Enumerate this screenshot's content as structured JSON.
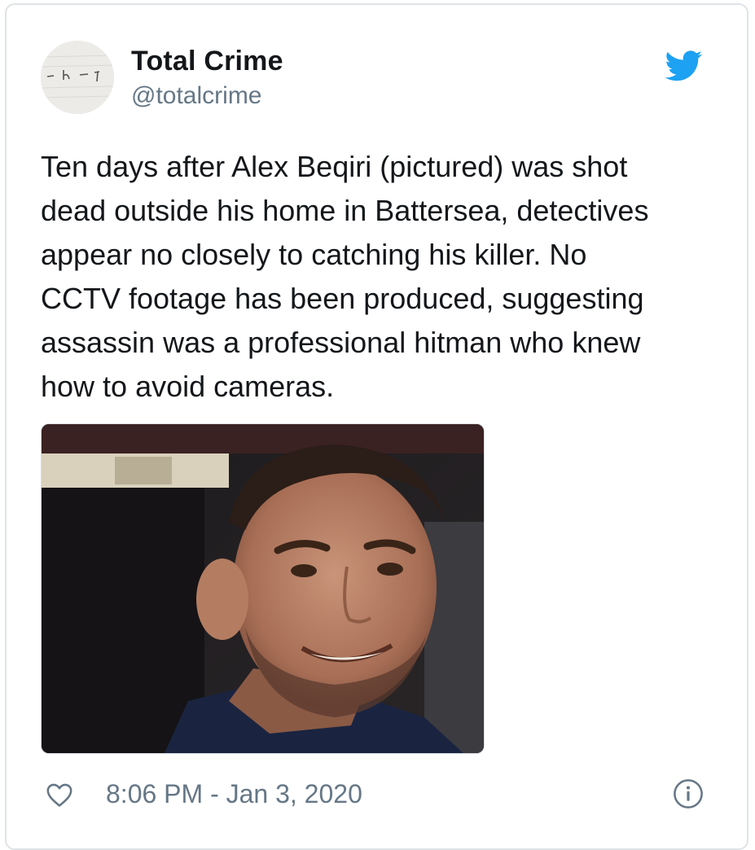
{
  "tweet": {
    "author": {
      "name": "Total Crime",
      "handle": "@totalcrime",
      "avatar_icon": "handwritten-note-avatar"
    },
    "platform_icon": "twitter-bird-icon",
    "text": "Ten days after Alex Beqiri (pictured) was shot\ndead outside his home in Battersea, detectives\nappear no closely to catching his killer. No\nCCTV footage has been produced, suggesting\nassassin was a professional hitman who knew\nhow to avoid cameras.",
    "media": {
      "type": "photo",
      "subject": "smiling-man-portrait"
    },
    "footer": {
      "like_icon": "heart-icon",
      "timestamp": "8:06 PM - Jan 3, 2020",
      "info_icon": "info-icon"
    }
  },
  "colors": {
    "text_primary": "#14171a",
    "text_secondary": "#657786",
    "twitter_blue": "#1da1f2",
    "border": "#dfe3e6"
  }
}
